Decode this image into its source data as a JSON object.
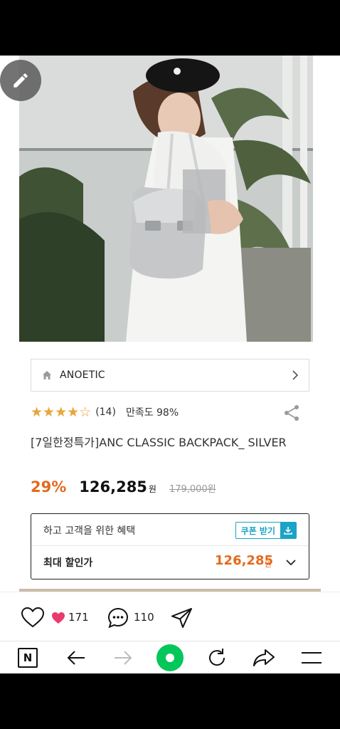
{
  "brand": {
    "name": "ANOETIC"
  },
  "rating": {
    "stars": "★★★★",
    "half_star": "☆",
    "count": "(14)",
    "satisfaction": "만족도 98%"
  },
  "product": {
    "title": "[7일한정특가]ANC CLASSIC BACKPACK_ SILVER"
  },
  "price": {
    "discount": "29%",
    "sale": "126,285",
    "won": "원",
    "original": "179,000원"
  },
  "coupon": {
    "header": "하고 고객을 위한 혜택",
    "button_label": "쿠폰 받기",
    "best_price_label": "최대 할인가",
    "best_price": "126,285",
    "best_price_won": "원"
  },
  "social": {
    "likes": "171",
    "comments": "110"
  },
  "icons": {
    "edit": "pencil-icon",
    "home": "home-icon",
    "share": "share-icon",
    "chevron": "chevron-right-icon",
    "download": "download-icon",
    "expand": "chevron-down-icon",
    "heart": "heart-outline-icon",
    "like": "heart-filled-icon",
    "comment": "comment-icon",
    "send": "send-icon",
    "naver": "naver-n-icon",
    "back": "arrow-left-icon",
    "forward": "arrow-right-icon",
    "green": "green-dot-icon",
    "refresh": "refresh-icon",
    "share_browser": "share-arrow-icon",
    "menu": "menu-icon"
  },
  "colors": {
    "accent_orange": "#e46a1e",
    "coupon_blue": "#1aa3c7",
    "star_gold": "#e8a53a",
    "like_pink": "#ea3a6c",
    "naver_green": "#03c75a"
  },
  "nav": {
    "naver_label": "N"
  }
}
